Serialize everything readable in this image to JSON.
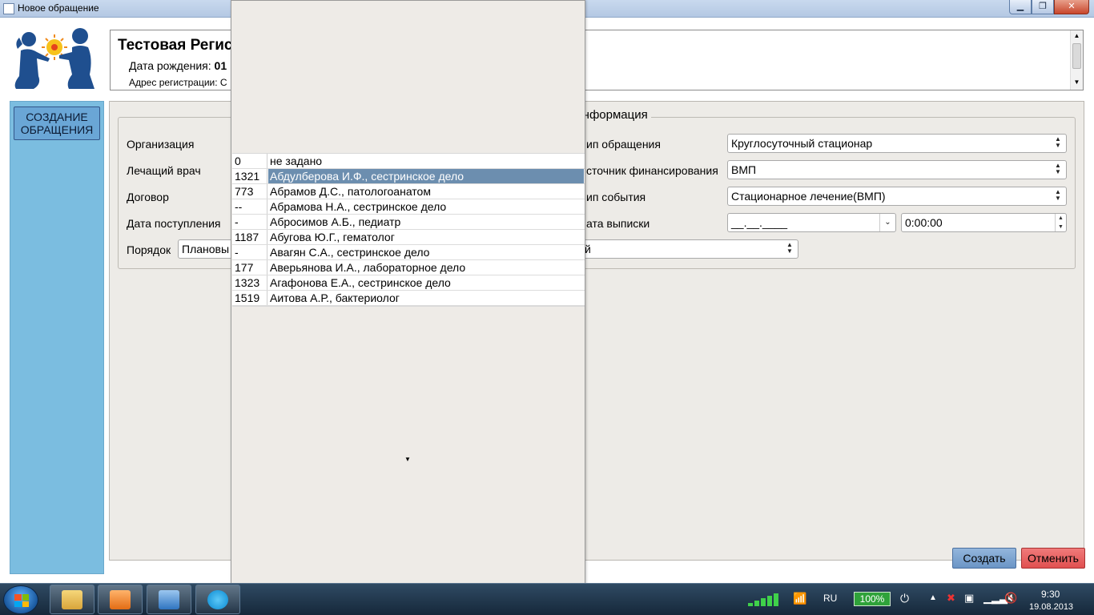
{
  "window": {
    "title": "Новое обращение",
    "minimize": "▁",
    "maximize": "❐",
    "close": "✕"
  },
  "patient": {
    "name": "Тестовая Регис",
    "dob_label": "Дата рождения:",
    "dob_value": "01",
    "address_label": "Адрес регистрации: С"
  },
  "sidebar": {
    "create_appeal": "СОЗДАНИЕ ОБРАЩЕНИЯ"
  },
  "form": {
    "group_title": "я информация",
    "left": {
      "organization_label": "Организация",
      "doctor_label": "Лечащий врач",
      "contract_label": "Договор",
      "admission_date_label": "Дата поступления",
      "order_label": "Порядок",
      "order_value": "Плановы"
    },
    "right": {
      "appeal_type_label": "ип обращения",
      "appeal_type_value": "Круглосуточный стационар",
      "funding_label": "сточник финансирования",
      "funding_value": "ВМП",
      "event_type_label": "ип события",
      "event_type_value": "Стационарное лечение(ВМП)",
      "discharge_label": "ата выписки",
      "discharge_date_value": "__.__.____",
      "discharge_time_value": "0:00:00",
      "extra_combo_value": "й"
    }
  },
  "buttons": {
    "create": "Создать",
    "cancel": "Отменить"
  },
  "doctor_popup": {
    "rows": [
      {
        "code": "0",
        "name": "не задано",
        "selected": false
      },
      {
        "code": "1321",
        "name": "Абдулберова И.Ф., сестринское дело",
        "selected": true
      },
      {
        "code": "773",
        "name": "Абрамов Д.С., патологоанатом",
        "selected": false
      },
      {
        "code": "--",
        "name": "Абрамова Н.А., сестринское дело",
        "selected": false
      },
      {
        "code": "-",
        "name": "Абросимов А.Б., педиатр",
        "selected": false
      },
      {
        "code": "1187",
        "name": "Абугова Ю.Г., гематолог",
        "selected": false
      },
      {
        "code": "-",
        "name": "Авагян С.А., сестринское дело",
        "selected": false
      },
      {
        "code": "177",
        "name": "Аверьянова И.А., лабораторное дело",
        "selected": false
      },
      {
        "code": "1323",
        "name": "Агафонова Е.А., сестринское дело",
        "selected": false
      },
      {
        "code": "1519",
        "name": "Аитова А.Р., бактериолог",
        "selected": false
      }
    ]
  },
  "taskbar": {
    "apps": [
      "file-explorer-icon",
      "outlook-icon",
      "lync-icon",
      "skype-icon"
    ],
    "language": "RU",
    "battery": "100%",
    "time": "9:30",
    "date": "19.08.2013"
  }
}
